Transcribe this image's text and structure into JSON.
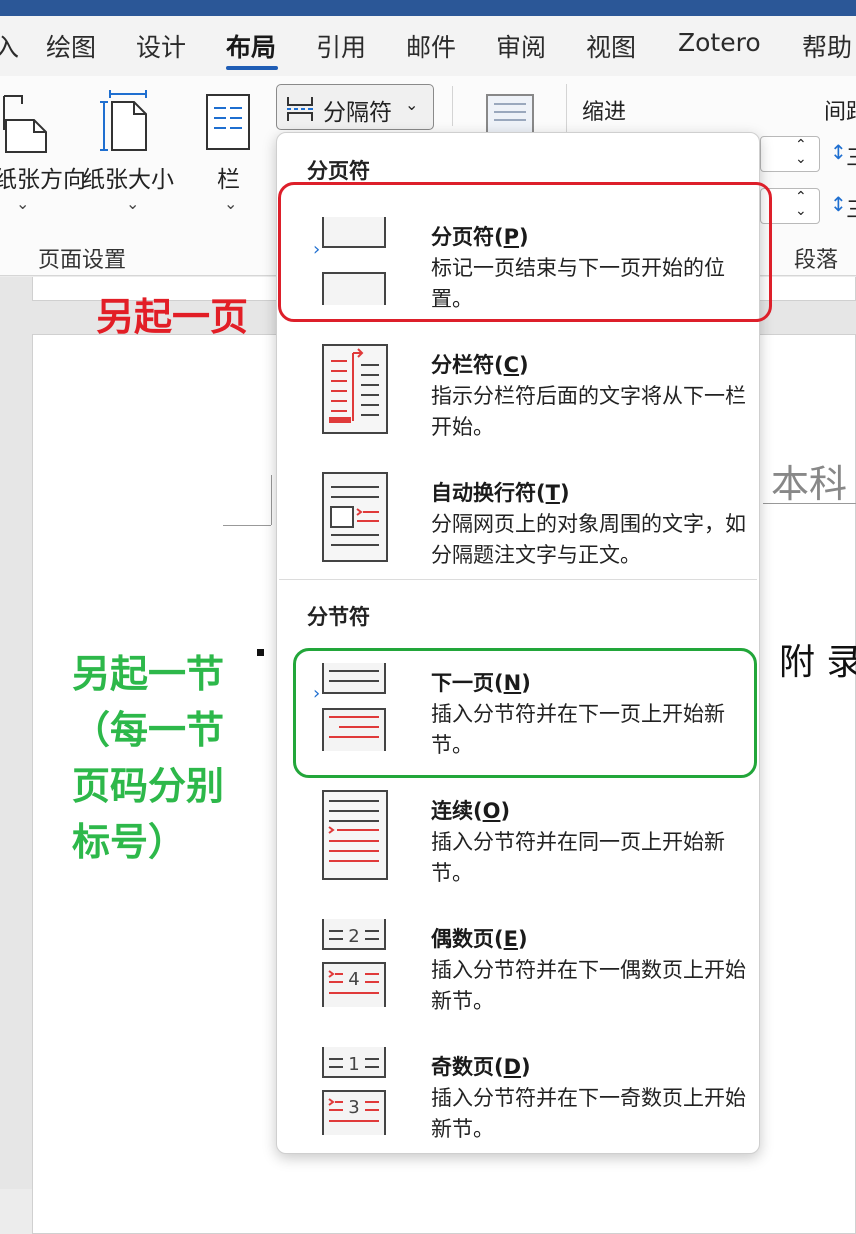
{
  "tabs": [
    "入",
    "绘图",
    "设计",
    "布局",
    "引用",
    "邮件",
    "审阅",
    "视图",
    "Zotero",
    "帮助"
  ],
  "ribbon": {
    "orientation_label": "纸张方向",
    "size_label": "纸张大小",
    "columns_label": "栏",
    "breaks_label": "分隔符",
    "line_numbers_partial": "",
    "indent_label": "缩进",
    "spacing_label": "间距",
    "page_setup_group": "页面设置",
    "paragraph_group": "段落",
    "spin_glyph_1": "三",
    "spin_glyph_2": "三"
  },
  "document": {
    "text_partial_1": "本科",
    "text_partial_2": "附 录"
  },
  "annotations": {
    "new_page": "另起一页",
    "new_section_lines": [
      "另起一节",
      "（每一节",
      "页码分别",
      "标号）"
    ],
    "red_color": "#e21e26",
    "green_color": "#2db84a"
  },
  "menu": {
    "page_breaks_header": "分页符",
    "section_breaks_header": "分节符",
    "items": [
      {
        "title": "分页符",
        "key": "P",
        "desc": "标记一页结束与下一页开始的位置。"
      },
      {
        "title": "分栏符",
        "key": "C",
        "desc": "指示分栏符后面的文字将从下一栏开始。"
      },
      {
        "title": "自动换行符",
        "key": "T",
        "desc": "分隔网页上的对象周围的文字，如分隔题注文字与正文。"
      },
      {
        "title": "下一页",
        "key": "N",
        "desc": "插入分节符并在下一页上开始新节。"
      },
      {
        "title": "连续",
        "key": "O",
        "desc": "插入分节符并在同一页上开始新节。"
      },
      {
        "title": "偶数页",
        "key": "E",
        "desc": "插入分节符并在下一偶数页上开始新节。"
      },
      {
        "title": "奇数页",
        "key": "D",
        "desc": "插入分节符并在下一奇数页上开始新节。"
      }
    ],
    "even_icon_top": "2",
    "even_icon_bottom": "4",
    "odd_icon_top": "1",
    "odd_icon_bottom": "3"
  }
}
